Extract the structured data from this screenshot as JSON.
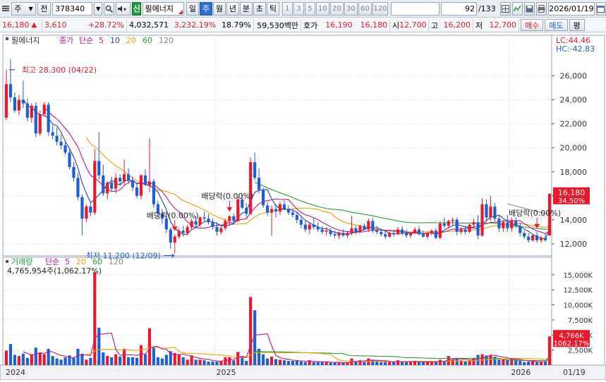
{
  "toolbar": {
    "market": "주",
    "prev_label": "전",
    "code": "378340",
    "badge": "신",
    "stock_name": "필에너지",
    "periods": [
      "일",
      "주",
      "월",
      "년",
      "분",
      "초",
      "틱"
    ],
    "active_period": "주",
    "intervals": [
      "1",
      "3",
      "5",
      "10",
      "20",
      "30",
      "60",
      "120"
    ],
    "count": "92",
    "count_total": "/133",
    "date": "2026/01/19"
  },
  "quote": {
    "price": "16,180",
    "change": "3,610",
    "change_pct": "+28.72%",
    "volume": "4,032,571",
    "volume_pct": "3,232.19%",
    "turnover_pct": "18.79%",
    "amount": "59,530백만",
    "bid_label": "호가",
    "ask": "16,190",
    "bid": "16,180",
    "open_label": "시",
    "open": "12,700",
    "high_label": "고",
    "high": "16,200",
    "low_label": "저",
    "low": "12,700",
    "buy_label": "매수",
    "sell_label": "매도",
    "extra_label": "평"
  },
  "colors": {
    "up": "#e8192c",
    "down": "#1f5fd0",
    "ma5": "#2f3e9e",
    "ma10": "#c2188c",
    "ma20": "#f0a000",
    "ma60": "#2b9a3a",
    "ma120": "#888888"
  },
  "chart_data": {
    "type": "candlestick",
    "title": "필에너지",
    "price_label": "종가",
    "ma_label": "단순",
    "ma_periods": [
      "5",
      "10",
      "20",
      "60",
      "120"
    ],
    "volume_title": "거래량",
    "volume_ma_periods": [
      "5",
      "20",
      "60",
      "120"
    ],
    "volume_info": "4,765,954주(1,062.17%)",
    "high_annotation": "최고 28,300 (04/22)",
    "low_annotation": "최저 11,200 (12/09)",
    "dividend_labels": [
      "배당락(0.00%)",
      "배당락(0.00%)",
      "배당락(0.00%)"
    ],
    "lc_label": "LC:44.46",
    "hc_label": "HC:-42.83",
    "current_price_label": "16,180",
    "current_change_label": "34.50%",
    "current_volume_label": "4,766K",
    "current_volume_pct_label": "1062.17%",
    "y_ticks": [
      "26,000",
      "24,000",
      "22,000",
      "20,000",
      "18,000",
      "16,000",
      "14,000",
      "12,000"
    ],
    "y_tick_values": [
      26000,
      24000,
      22000,
      20000,
      18000,
      16000,
      14000,
      12000
    ],
    "ylim": [
      11000,
      29200
    ],
    "vol_ticks": [
      "15,000K",
      "12,500K",
      "10,000K",
      "7,500K",
      "5,000K",
      "2,500K"
    ],
    "vol_tick_values": [
      15000,
      12500,
      10000,
      7500,
      5000,
      2500
    ],
    "vol_ylim": [
      0,
      16500
    ],
    "x_labels": [
      "2024",
      "2025",
      "2026",
      "01/19"
    ],
    "x_label_index": [
      0,
      50,
      120,
      133
    ],
    "ohlc": [
      [
        22500,
        26500,
        22300,
        25300
      ],
      [
        25300,
        27400,
        23800,
        24200
      ],
      [
        24200,
        24600,
        22900,
        23100
      ],
      [
        23100,
        24400,
        22700,
        24000
      ],
      [
        24000,
        25600,
        23300,
        23700
      ],
      [
        23700,
        24100,
        22200,
        22500
      ],
      [
        22500,
        23700,
        22100,
        23500
      ],
      [
        23500,
        23800,
        20900,
        21200
      ],
      [
        21200,
        23100,
        21000,
        22800
      ],
      [
        22800,
        23800,
        22600,
        23600
      ],
      [
        23600,
        23800,
        21000,
        21300
      ],
      [
        21300,
        21900,
        20700,
        21000
      ],
      [
        21000,
        21700,
        20200,
        20500
      ],
      [
        20500,
        21100,
        19900,
        20200
      ],
      [
        20200,
        20600,
        19400,
        19600
      ],
      [
        19600,
        19900,
        18200,
        18400
      ],
      [
        18400,
        18800,
        17200,
        17500
      ],
      [
        17500,
        17900,
        15600,
        15900
      ],
      [
        15900,
        16100,
        12700,
        14100
      ],
      [
        14100,
        15300,
        13800,
        15100
      ],
      [
        15100,
        15400,
        14300,
        14600
      ],
      [
        14600,
        19900,
        14400,
        18900
      ],
      [
        18900,
        21300,
        17400,
        17700
      ],
      [
        17700,
        18600,
        16000,
        16200
      ],
      [
        16200,
        17200,
        15700,
        17100
      ],
      [
        17100,
        17600,
        16300,
        16600
      ],
      [
        16600,
        17900,
        16200,
        17500
      ],
      [
        17500,
        17800,
        16800,
        17200
      ],
      [
        17200,
        19000,
        16900,
        17800
      ],
      [
        17800,
        18300,
        17000,
        17300
      ],
      [
        17300,
        17600,
        16400,
        16700
      ],
      [
        16700,
        17100,
        15800,
        16000
      ],
      [
        16000,
        17800,
        15700,
        17700
      ],
      [
        17700,
        18200,
        16800,
        16900
      ],
      [
        16900,
        20800,
        16300,
        17200
      ],
      [
        17200,
        17400,
        15000,
        15300
      ],
      [
        15300,
        15600,
        14200,
        14500
      ],
      [
        14500,
        14900,
        13700,
        14100
      ],
      [
        14100,
        14400,
        12900,
        13200
      ],
      [
        13200,
        13400,
        11600,
        12100
      ],
      [
        12100,
        12800,
        11200,
        12600
      ],
      [
        12600,
        13300,
        12400,
        13100
      ],
      [
        13100,
        13500,
        12600,
        12900
      ],
      [
        12900,
        13600,
        12700,
        13400
      ],
      [
        13400,
        14100,
        13200,
        13900
      ],
      [
        13900,
        14300,
        13300,
        13600
      ],
      [
        13600,
        14300,
        13400,
        14200
      ],
      [
        14200,
        14700,
        13800,
        14100
      ],
      [
        14100,
        14500,
        13600,
        13800
      ],
      [
        13800,
        14100,
        13200,
        13400
      ],
      [
        13400,
        13800,
        12700,
        13000
      ],
      [
        13000,
        13500,
        12800,
        13300
      ],
      [
        13300,
        14100,
        13100,
        13900
      ],
      [
        13900,
        14400,
        13500,
        14300
      ],
      [
        14300,
        14500,
        13700,
        13900
      ],
      [
        13900,
        15900,
        13800,
        15700
      ],
      [
        15700,
        16100,
        14900,
        15000
      ],
      [
        15000,
        15400,
        14200,
        14500
      ],
      [
        14500,
        19200,
        14400,
        18800
      ],
      [
        18800,
        19600,
        17300,
        17500
      ],
      [
        17500,
        18300,
        16200,
        16500
      ],
      [
        16500,
        16700,
        15000,
        15200
      ],
      [
        15200,
        15500,
        14300,
        14600
      ],
      [
        14600,
        15200,
        12700,
        14900
      ],
      [
        14900,
        15300,
        14200,
        14700
      ],
      [
        14700,
        15500,
        14400,
        15300
      ],
      [
        15300,
        15600,
        14800,
        14900
      ],
      [
        14900,
        15200,
        14400,
        14600
      ],
      [
        14600,
        14900,
        14200,
        14400
      ],
      [
        14400,
        14700,
        13700,
        14000
      ],
      [
        14000,
        14200,
        13300,
        13600
      ],
      [
        13600,
        13900,
        13000,
        13200
      ],
      [
        13200,
        13800,
        12800,
        13600
      ],
      [
        13600,
        14200,
        13200,
        13400
      ],
      [
        13400,
        13800,
        13000,
        13200
      ],
      [
        13200,
        13500,
        12800,
        13000
      ],
      [
        13000,
        13400,
        12700,
        13100
      ],
      [
        13100,
        13300,
        12600,
        12800
      ],
      [
        12800,
        13100,
        12500,
        12700
      ],
      [
        12700,
        13000,
        12400,
        12900
      ],
      [
        12900,
        13200,
        12600,
        12700
      ],
      [
        12700,
        13000,
        12500,
        12900
      ],
      [
        12900,
        14300,
        12700,
        13300
      ],
      [
        13300,
        13500,
        12800,
        13000
      ],
      [
        13000,
        13600,
        12900,
        13500
      ],
      [
        13500,
        13700,
        13100,
        13200
      ],
      [
        13200,
        14100,
        13000,
        13900
      ],
      [
        13900,
        14200,
        12900,
        13100
      ],
      [
        13100,
        13500,
        12800,
        13000
      ],
      [
        13000,
        13200,
        12600,
        12800
      ],
      [
        12800,
        13100,
        12400,
        12600
      ],
      [
        12600,
        13000,
        12500,
        12900
      ],
      [
        12900,
        13200,
        12600,
        12800
      ],
      [
        12800,
        13400,
        12700,
        13200
      ],
      [
        13200,
        13500,
        12700,
        12900
      ],
      [
        12900,
        13200,
        12500,
        12700
      ],
      [
        12700,
        13000,
        12500,
        12900
      ],
      [
        12900,
        13400,
        12800,
        13200
      ],
      [
        13200,
        13500,
        12700,
        12800
      ],
      [
        12800,
        13100,
        12500,
        12600
      ],
      [
        12600,
        13000,
        12400,
        12900
      ],
      [
        12900,
        13200,
        12700,
        13100
      ],
      [
        13100,
        13300,
        12400,
        12500
      ],
      [
        12500,
        13900,
        12400,
        13700
      ],
      [
        13700,
        14200,
        13300,
        13500
      ],
      [
        13500,
        14000,
        13300,
        13900
      ],
      [
        13900,
        14200,
        13500,
        14000
      ],
      [
        14000,
        14200,
        12700,
        13000
      ],
      [
        13000,
        13400,
        12800,
        13200
      ],
      [
        13200,
        13500,
        12800,
        13000
      ],
      [
        13000,
        13700,
        12900,
        13600
      ],
      [
        13600,
        14100,
        13300,
        13800
      ],
      [
        13800,
        14400,
        12400,
        12700
      ],
      [
        12700,
        15800,
        12600,
        15300
      ],
      [
        15300,
        15700,
        13900,
        14200
      ],
      [
        14200,
        16000,
        13900,
        15100
      ],
      [
        15100,
        15400,
        13900,
        14100
      ],
      [
        14100,
        14400,
        13000,
        13300
      ],
      [
        13300,
        14000,
        13000,
        13800
      ],
      [
        13800,
        14400,
        13000,
        13300
      ],
      [
        13300,
        14200,
        13000,
        13900
      ],
      [
        13900,
        14200,
        13300,
        13500
      ],
      [
        13500,
        13800,
        12600,
        12900
      ],
      [
        12900,
        13100,
        12400,
        12600
      ],
      [
        12600,
        12900,
        12100,
        12300
      ],
      [
        12300,
        12800,
        12200,
        12700
      ],
      [
        12700,
        13000,
        12100,
        12300
      ],
      [
        12300,
        12700,
        12100,
        12500
      ],
      [
        12500,
        12900,
        12200,
        12300
      ],
      [
        12700,
        16200,
        12700,
        16180
      ]
    ],
    "volume": [
      2400,
      3500,
      1700,
      1500,
      1900,
      1200,
      1800,
      2900,
      2100,
      1800,
      2700,
      1500,
      1100,
      900,
      1300,
      1600,
      1200,
      2700,
      1900,
      900,
      1200,
      15400,
      6200,
      2100,
      1500,
      1300,
      1800,
      1400,
      2700,
      1300,
      1300,
      1200,
      3300,
      1800,
      6100,
      3000,
      1300,
      1100,
      1700,
      2300,
      2000,
      1700,
      1300,
      900,
      1600,
      900,
      900,
      800,
      600,
      600,
      600,
      700,
      1300,
      1300,
      800,
      2200,
      1500,
      700,
      11300,
      9100,
      2700,
      1800,
      1100,
      1400,
      1000,
      900,
      800,
      700,
      700,
      700,
      600,
      500,
      800,
      500,
      500,
      500,
      500,
      400,
      400,
      400,
      400,
      400,
      1100,
      600,
      800,
      500,
      1100,
      900,
      700,
      500,
      500,
      500,
      500,
      800,
      500,
      500,
      500,
      700,
      500,
      500,
      500,
      500,
      600,
      900,
      700,
      1500,
      900,
      1200,
      800,
      600,
      700,
      1200,
      1700,
      1800,
      1600,
      1700,
      1400,
      900,
      1100,
      900,
      1000,
      900,
      700,
      500,
      600,
      700,
      500,
      500,
      600,
      4766
    ],
    "dividend_index": [
      40,
      53,
      126
    ],
    "high_index": 0,
    "low_index": 40
  }
}
